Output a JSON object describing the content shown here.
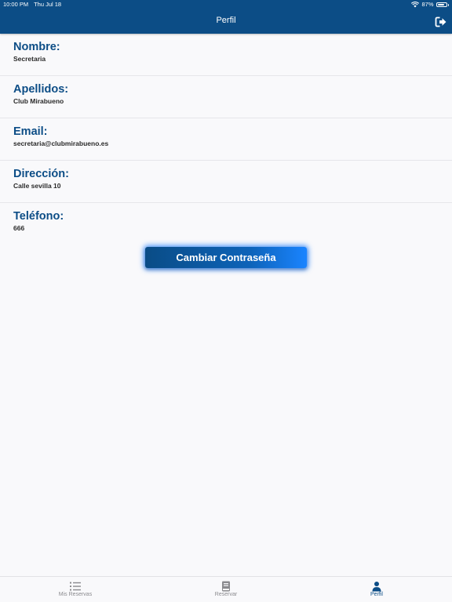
{
  "status_bar": {
    "time": "10:00 PM",
    "date": "Thu Jul 18",
    "battery_text": "87%",
    "battery_level": 0.87,
    "icons": [
      "wifi-icon",
      "battery-icon"
    ]
  },
  "header": {
    "title": "Perfil",
    "logout_icon": "logout-icon"
  },
  "profile": {
    "fields": [
      {
        "label": "Nombre:",
        "value": "Secretaria"
      },
      {
        "label": "Apellidos:",
        "value": "Club Mirabueno"
      },
      {
        "label": "Email:",
        "value": "secretaria@clubmirabueno.es"
      },
      {
        "label": "Dirección:",
        "value": "Calle sevilla 10"
      },
      {
        "label": "Teléfono:",
        "value": "666"
      }
    ]
  },
  "actions": {
    "change_password_label": "Cambiar Contraseña"
  },
  "tab_bar": {
    "tabs": [
      {
        "label": "Mis Reservas",
        "icon": "list-icon",
        "active": false
      },
      {
        "label": "Reservar",
        "icon": "book-icon",
        "active": false
      },
      {
        "label": "Perfil",
        "icon": "person-icon",
        "active": true
      }
    ]
  },
  "colors": {
    "primary": "#0c4d86",
    "accent_glow": "#1a84ff",
    "background": "#f9f9fb",
    "inactive_tab": "#8a8a8e"
  }
}
